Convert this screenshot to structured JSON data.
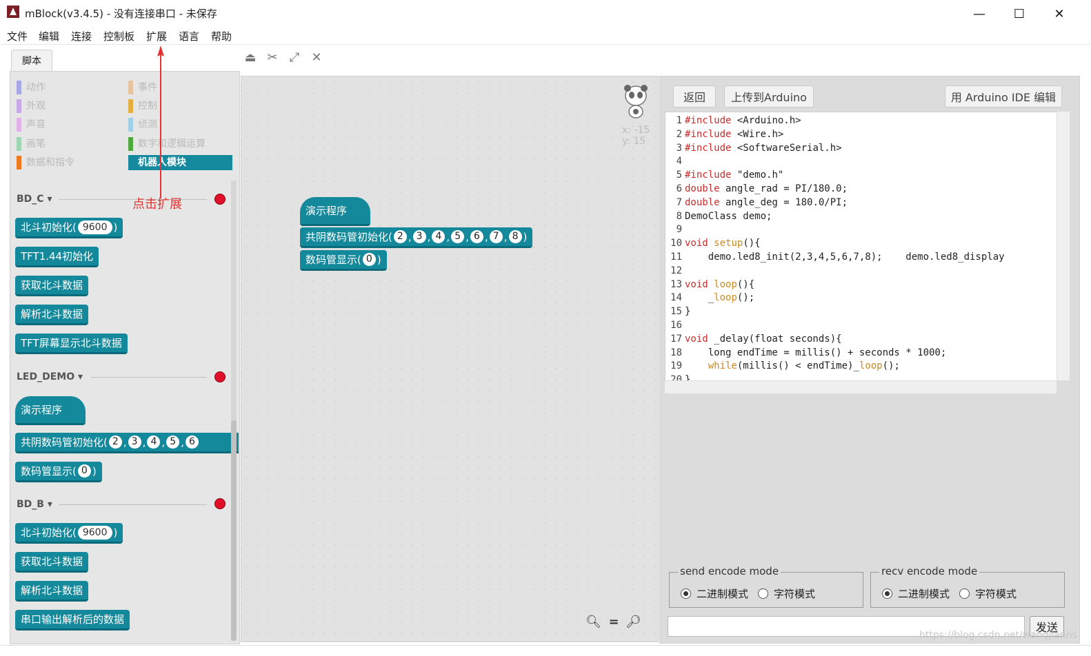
{
  "window": {
    "title": "mBlock(v3.4.5) - 没有连接串口 - 未保存",
    "minimize": "—",
    "maximize": "☐",
    "close": "✕"
  },
  "menu": [
    "文件",
    "编辑",
    "连接",
    "控制板",
    "扩展",
    "语言",
    "帮助"
  ],
  "tab": {
    "label": "脚本"
  },
  "categories": [
    {
      "label": "动作",
      "color": "#a8a8e8"
    },
    {
      "label": "外观",
      "color": "#c9a8e8"
    },
    {
      "label": "声音",
      "color": "#e0b0e8"
    },
    {
      "label": "画笔",
      "color": "#9fd6b4"
    },
    {
      "label": "数据和指令",
      "color": "#ee7b1f"
    },
    {
      "label": "事件",
      "color": "#e6c4a0"
    },
    {
      "label": "控制",
      "color": "#e6b041"
    },
    {
      "label": "侦测",
      "color": "#9fd0e8"
    },
    {
      "label": "数字和逻辑运算",
      "color": "#4eaa3c"
    },
    {
      "label": "机器人模块",
      "color": "#15899e"
    }
  ],
  "annotation": "点击扩展",
  "sections": {
    "bd_c": {
      "title": "BD_C",
      "blocks": [
        "北斗初始化(",
        "TFT1.44初始化",
        "获取北斗数据",
        "解析北斗数据",
        "TFT屏幕显示北斗数据"
      ],
      "baud": "9600"
    },
    "led_demo": {
      "title": "LED_DEMO",
      "hat": "演示程序",
      "init": "共阴数码管初始化(",
      "pins": [
        "2",
        "3",
        "4",
        "5",
        "6"
      ],
      "display": "数码管显示(",
      "display_val": "0"
    },
    "bd_b": {
      "title": "BD_B",
      "blocks": [
        "北斗初始化(",
        "获取北斗数据",
        "解析北斗数据",
        "串口输出解析后的数据"
      ],
      "baud": "9600"
    }
  },
  "canvas": {
    "hat": "演示程序",
    "init": "共阴数码管初始化(",
    "pins": [
      "2",
      "3",
      "4",
      "5",
      "6",
      "7",
      "8"
    ],
    "display": "数码管显示(",
    "display_val": "0",
    "x_label": "x:",
    "x_val": "-15",
    "y_label": "y:",
    "y_val": "15"
  },
  "right": {
    "back": "返回",
    "upload": "上传到Arduino",
    "ide": "用 Arduino IDE 编辑",
    "send_mode": {
      "legend": "send encode mode",
      "opt1": "二进制模式",
      "opt2": "字符模式"
    },
    "recv_mode": {
      "legend": "recv encode mode",
      "opt1": "二进制模式",
      "opt2": "字符模式"
    },
    "send_btn": "发送"
  },
  "code_lines": [
    {
      "n": "1",
      "parts": [
        [
          "kw",
          "#include"
        ],
        [
          "",
          " <Arduino.h>"
        ]
      ]
    },
    {
      "n": "2",
      "parts": [
        [
          "kw",
          "#include"
        ],
        [
          "",
          " <Wire.h>"
        ]
      ]
    },
    {
      "n": "3",
      "parts": [
        [
          "kw",
          "#include"
        ],
        [
          "",
          " <SoftwareSerial.h>"
        ]
      ]
    },
    {
      "n": "4",
      "parts": []
    },
    {
      "n": "5",
      "parts": [
        [
          "kw",
          "#include"
        ],
        [
          "",
          " \"demo.h\""
        ]
      ]
    },
    {
      "n": "6",
      "parts": [
        [
          "kw",
          "double"
        ],
        [
          "",
          " angle_rad = PI/180.0;"
        ]
      ]
    },
    {
      "n": "7",
      "parts": [
        [
          "kw",
          "double"
        ],
        [
          "",
          " angle_deg = 180.0/PI;"
        ]
      ]
    },
    {
      "n": "8",
      "parts": [
        [
          "",
          "DemoClass demo;"
        ]
      ]
    },
    {
      "n": "9",
      "parts": []
    },
    {
      "n": "10",
      "parts": [
        [
          "kw",
          "void"
        ],
        [
          "",
          " "
        ],
        [
          "fn",
          "setup"
        ],
        [
          "",
          "(){"
        ]
      ]
    },
    {
      "n": "11",
      "parts": [
        [
          "",
          "    demo.led8_init(2,3,4,5,6,7,8);    demo.led8_display"
        ]
      ]
    },
    {
      "n": "12",
      "parts": []
    },
    {
      "n": "13",
      "parts": [
        [
          "kw",
          "void"
        ],
        [
          "",
          " "
        ],
        [
          "fn",
          "loop"
        ],
        [
          "",
          "(){"
        ]
      ]
    },
    {
      "n": "14",
      "parts": [
        [
          "",
          "    _"
        ],
        [
          "fn",
          "loop"
        ],
        [
          "",
          "();"
        ]
      ]
    },
    {
      "n": "15",
      "parts": [
        [
          "",
          "}"
        ]
      ]
    },
    {
      "n": "16",
      "parts": []
    },
    {
      "n": "17",
      "parts": [
        [
          "kw",
          "void"
        ],
        [
          "",
          " _delay(float seconds){"
        ]
      ]
    },
    {
      "n": "18",
      "parts": [
        [
          "",
          "    long endTime = millis() + seconds * 1000;"
        ]
      ]
    },
    {
      "n": "19",
      "parts": [
        [
          "",
          "    "
        ],
        [
          "fn",
          "while"
        ],
        [
          "",
          "(millis() < endTime)_"
        ],
        [
          "fn",
          "loop"
        ],
        [
          "",
          "();"
        ]
      ]
    },
    {
      "n": "20",
      "parts": [
        [
          "",
          "}"
        ]
      ]
    }
  ],
  "watermark": "https://blog.csdn.net/wangjianhs"
}
